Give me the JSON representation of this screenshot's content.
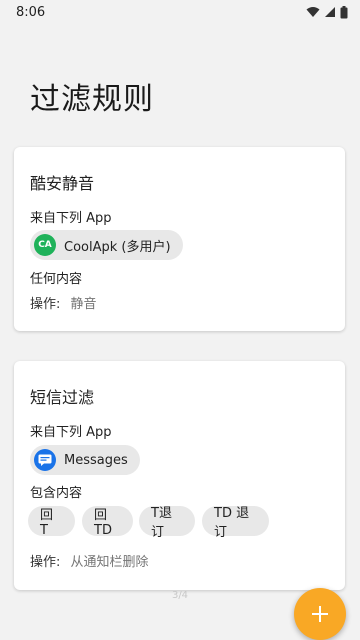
{
  "status_bar": {
    "time": "8:06"
  },
  "page": {
    "title": "过滤规则",
    "indicator": "3/4"
  },
  "rules": [
    {
      "title": "酷安静音",
      "apps_label": "来自下列 App",
      "app": {
        "name": "CoolApk (多用户)",
        "icon_text": "CA",
        "icon": "coolapk-icon",
        "icon_color": "#1fb25a"
      },
      "content_label": "任何内容",
      "action_label": "操作:",
      "action_value": "静音"
    },
    {
      "title": "短信过滤",
      "apps_label": "来自下列 App",
      "app": {
        "name": "Messages",
        "icon": "messages-icon",
        "icon_color": "#1a73e8"
      },
      "content_label": "包含内容",
      "keywords": [
        "回 T",
        "回TD",
        "T退订",
        "TD 退订"
      ],
      "action_label": "操作:",
      "action_value": "从通知栏删除"
    }
  ],
  "fab": {
    "icon": "plus-icon",
    "color": "#f9a825"
  }
}
